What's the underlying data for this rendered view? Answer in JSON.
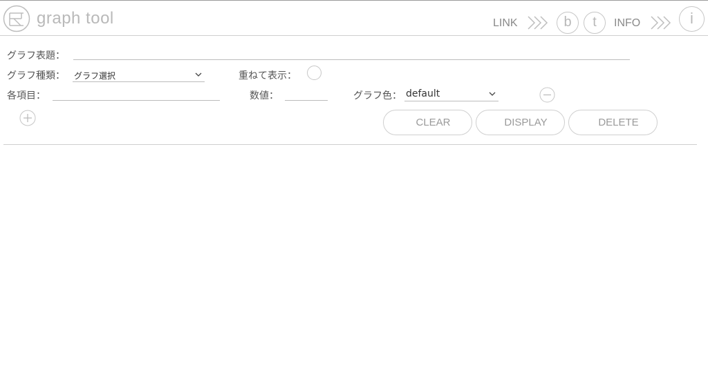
{
  "header": {
    "app_title": "graph tool",
    "link_label": "LINK",
    "info_label": "INFO",
    "b_icon_text": "b",
    "t_icon_text": "t",
    "i_icon_text": "i"
  },
  "form": {
    "graph_title_label": "グラフ表題：",
    "graph_title_value": "",
    "graph_type_label": "グラフ種類：",
    "graph_type_selected": "グラフ選択",
    "overlay_label": "重ねて表示：",
    "item_label": "各項目：",
    "item_value": "",
    "value_label": "数値：",
    "value_value": "",
    "graph_color_label": "グラフ色：",
    "graph_color_selected": "default"
  },
  "buttons": {
    "clear": "CLEAR",
    "display": "DISPLAY",
    "delete": "DELETE"
  },
  "colors": {
    "border": "#cfcfcf",
    "muted_text": "#9a9a9a",
    "logo": "#bdbdbd"
  }
}
